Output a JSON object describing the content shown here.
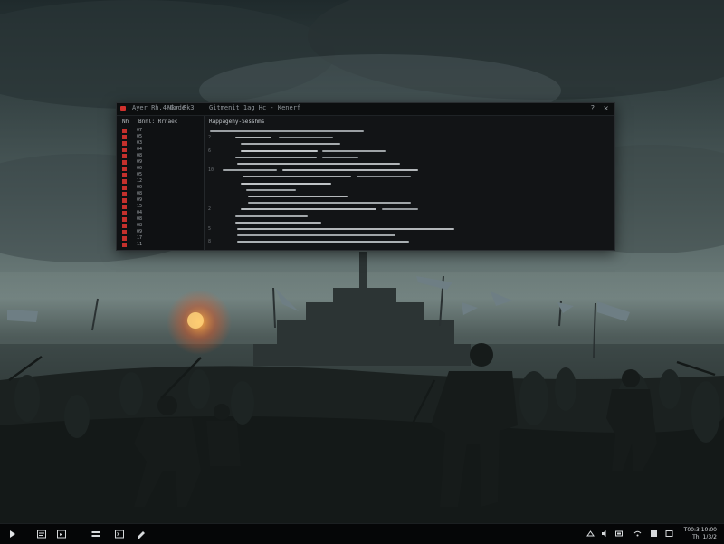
{
  "editor": {
    "title": "Ayer Rh.4-Code",
    "tab_label": "Nkr Pk3",
    "doc_title": "Gitmenit 1ag Hc - Kenerf",
    "win_controls": {
      "help": "?",
      "close": "×"
    },
    "sidebar": {
      "header_a": "Nh",
      "header_b": "Bnnl: Rrnaec",
      "rows": [
        "07",
        "05",
        "03",
        "04",
        "08",
        "09",
        "00",
        "05",
        "12",
        "00",
        "08",
        "09",
        "15",
        "04",
        "08",
        "08",
        "09",
        "17",
        "11"
      ]
    },
    "code_header": "Rappagehy-Sesshms",
    "code_lines": [
      {
        "ln": "",
        "segs": [
          [
            6,
            170,
            "#9a9fa3"
          ]
        ]
      },
      {
        "ln": "2",
        "segs": [
          [
            34,
            40,
            "#b3b7ba"
          ],
          [
            82,
            60,
            "#8f9498"
          ]
        ]
      },
      {
        "ln": "",
        "segs": [
          [
            40,
            110,
            "#a6abae"
          ]
        ]
      },
      {
        "ln": "6",
        "segs": [
          [
            40,
            85,
            "#c2c6c9"
          ],
          [
            130,
            70,
            "#9ea3a6"
          ]
        ]
      },
      {
        "ln": "",
        "segs": [
          [
            34,
            90,
            "#a2a7aa"
          ],
          [
            130,
            40,
            "#8c9195"
          ]
        ]
      },
      {
        "ln": "",
        "segs": [
          [
            36,
            180,
            "#b0b4b7"
          ]
        ]
      },
      {
        "ln": "10",
        "segs": [
          [
            20,
            60,
            "#9da2a5"
          ],
          [
            86,
            150,
            "#b4b8bb"
          ]
        ]
      },
      {
        "ln": "",
        "segs": [
          [
            42,
            120,
            "#a9adb0"
          ],
          [
            168,
            60,
            "#8e9397"
          ]
        ]
      },
      {
        "ln": "",
        "segs": [
          [
            40,
            100,
            "#c0c4c7"
          ]
        ]
      },
      {
        "ln": "",
        "segs": [
          [
            46,
            55,
            "#9a9fa2"
          ]
        ]
      },
      {
        "ln": "",
        "segs": [
          [
            48,
            110,
            "#b5b9bc"
          ]
        ]
      },
      {
        "ln": "",
        "segs": [
          [
            48,
            180,
            "#a1a6a9"
          ]
        ]
      },
      {
        "ln": "2",
        "segs": [
          [
            40,
            150,
            "#b8bcbf"
          ],
          [
            196,
            40,
            "#959a9e"
          ]
        ]
      },
      {
        "ln": "",
        "segs": [
          [
            34,
            80,
            "#a3a8ab"
          ]
        ]
      },
      {
        "ln": "",
        "segs": [
          [
            34,
            95,
            "#aeb2b5"
          ]
        ]
      },
      {
        "ln": "5",
        "segs": [
          [
            36,
            240,
            "#b2b6b9"
          ]
        ]
      },
      {
        "ln": "",
        "segs": [
          [
            36,
            175,
            "#9fa4a7"
          ]
        ]
      },
      {
        "ln": "8",
        "segs": [
          [
            36,
            190,
            "#aab0b3"
          ]
        ]
      }
    ]
  },
  "taskbar": {
    "clock_time": "T00:3 10:00",
    "clock_date": "Th: 1/3/2"
  },
  "icons": {
    "start": "start-icon",
    "file_explorer": "file-explorer-icon",
    "browser": "browser-icon",
    "task_view": "task-view-icon",
    "terminal": "terminal-icon",
    "editor": "editor-icon"
  }
}
